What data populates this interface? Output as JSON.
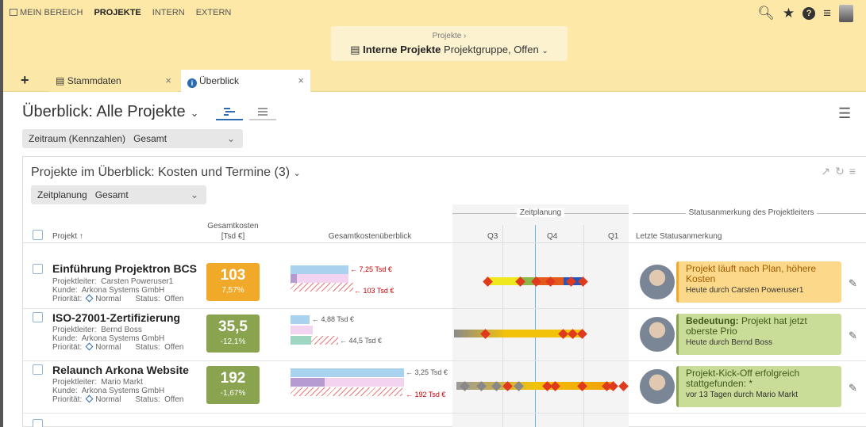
{
  "nav": {
    "items": [
      "MEIN BEREICH",
      "PROJEKTE",
      "INTERN",
      "EXTERN"
    ],
    "active": "PROJEKTE"
  },
  "breadcrumb": {
    "parent": "Projekte ›",
    "title": "Interne Projekte",
    "subtitle": "Projektgruppe, Offen"
  },
  "tabs": [
    {
      "label": "Stammdaten"
    },
    {
      "label": "Überblick"
    }
  ],
  "page": {
    "title": "Überblick: Alle Projekte"
  },
  "filter_zeitraum": {
    "label": "Zeitraum (Kennzahlen)",
    "value": "Gesamt"
  },
  "panel": {
    "title": "Projekte im Überblick: Kosten und Termine (3)"
  },
  "filter_zeitplanung": {
    "label": "Zeitplanung",
    "value": "Gesamt"
  },
  "columns": {
    "projekt": "Projekt ↑",
    "kosten1": "Gesamtkosten",
    "kosten2": "[Tsd €]",
    "overview": "Gesamtkostenüberblick",
    "zeitplanung": "Zeitplanung",
    "q3": "Q3",
    "q4": "Q4",
    "q1": "Q1",
    "status_group": "Statusanmerkung des Projektleiters",
    "letzte": "Letzte Statusanmerkung"
  },
  "labels": {
    "projektleiter": "Projektleiter:",
    "kunde": "Kunde:",
    "prioritaet": "Priorität:",
    "status": "Status:"
  },
  "colors": {
    "kpi_orange": "#f1a92a",
    "kpi_green": "#8aa34f",
    "status_orange": "#fcd98a",
    "status_green": "#c9dc98"
  },
  "projects": [
    {
      "name": "Einführung Projektron BCS",
      "leader": "Carsten Poweruser1",
      "customer": "Arkona Systems GmbH",
      "priority": "Normal",
      "status": "Offen",
      "kpi_value": "103",
      "kpi_pct": "7,57%",
      "ov_label_a": "7,25 Tsd €",
      "ov_label_b": "103 Tsd €",
      "status_prefix": "",
      "status_text": "Projekt läuft nach Plan, höhere Kosten",
      "status_by": "Heute durch Carsten Poweruser1"
    },
    {
      "name": "ISO-27001-Zertifizierung",
      "leader": "Bernd Boss",
      "customer": "Arkona Systems GmbH",
      "priority": "Normal",
      "status": "Offen",
      "kpi_value": "35,5",
      "kpi_pct": "-12,1%",
      "ov_label_a": "4,88 Tsd €",
      "ov_label_b": "44,5 Tsd €",
      "status_prefix": "Bedeutung:",
      "status_text": "Projekt hat jetzt oberste Prio",
      "status_by": "Heute durch Bernd Boss"
    },
    {
      "name": "Relaunch Arkona Website",
      "leader": "Mario Markt",
      "customer": "Arkona Systems GmbH",
      "priority": "Normal",
      "status": "Offen",
      "kpi_value": "192",
      "kpi_pct": "-1,67%",
      "ov_label_a": "3,25 Tsd €",
      "ov_label_b": "192 Tsd €",
      "status_prefix": "",
      "status_text": "Projekt-Kick-Off erfolgreich stattgefunden: *",
      "status_by": "vor 13 Tagen durch Mario Markt"
    }
  ]
}
